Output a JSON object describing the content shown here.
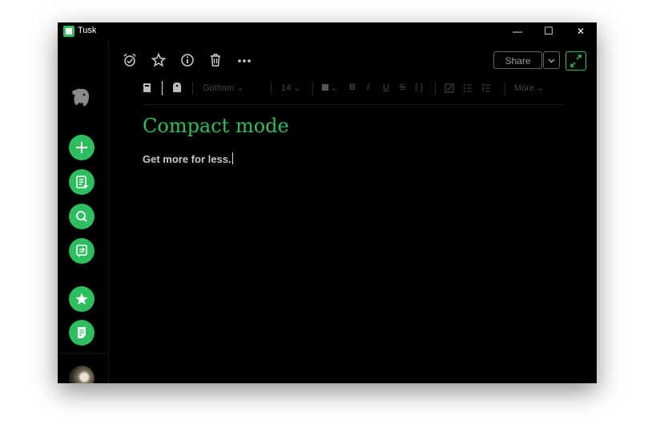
{
  "app": {
    "title": "Tusk"
  },
  "window_controls": {
    "minimize": "—",
    "maximize": "☐",
    "close": "✕"
  },
  "sidebar": {
    "items": [
      {
        "name": "new-note",
        "icon": "plus-icon"
      },
      {
        "name": "notes",
        "icon": "note-add-icon"
      },
      {
        "name": "search",
        "icon": "search-icon"
      },
      {
        "name": "work-chat",
        "icon": "chat-icon"
      },
      {
        "name": "shortcuts",
        "icon": "star-icon"
      },
      {
        "name": "notebooks",
        "icon": "notebook-icon"
      }
    ],
    "accent": "#2dbe60"
  },
  "note_actions": {
    "icons": [
      "reminder-icon",
      "star-icon",
      "info-icon",
      "trash-icon",
      "more-icon"
    ],
    "share_label": "Share"
  },
  "toolbar": {
    "font": "Gotham",
    "size": "14",
    "more_label": "More",
    "bold": "B",
    "italic": "I",
    "underline": "U",
    "strike": "S",
    "code": "{ }"
  },
  "note": {
    "title": "Compact mode",
    "body": "Get more for less."
  },
  "colors": {
    "accent": "#2dbe60",
    "background": "#000000"
  }
}
